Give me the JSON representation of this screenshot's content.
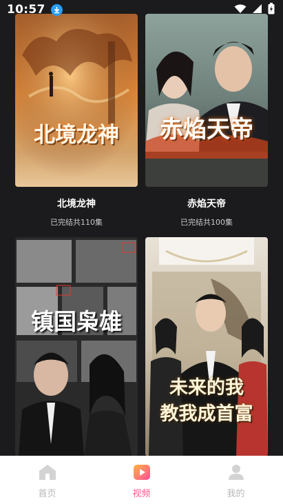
{
  "status_bar": {
    "time": "10:57"
  },
  "videos": [
    {
      "title_art": "北境龙神",
      "name": "北境龙神",
      "status": "已完结共110集"
    },
    {
      "title_art": "赤焰天帝",
      "name": "赤焰天帝",
      "status": "已完结共100集"
    },
    {
      "title_art": "镇国枭雄",
      "name": "",
      "status": ""
    },
    {
      "title_art": "未来的我教我成首富",
      "name": "",
      "status": ""
    }
  ],
  "poster_titles": {
    "p1": "北境龙神",
    "p2": "赤焰天帝",
    "p3": "镇国枭雄",
    "p4_line1": "未来的我",
    "p4_line2": "教我成首富"
  },
  "nav": {
    "home": "首页",
    "video": "视频",
    "mine": "我的",
    "active": "video"
  },
  "colors": {
    "background": "#1b1b1d",
    "accent": "#ff5a8a",
    "nav_inactive": "#b8b8b8"
  }
}
